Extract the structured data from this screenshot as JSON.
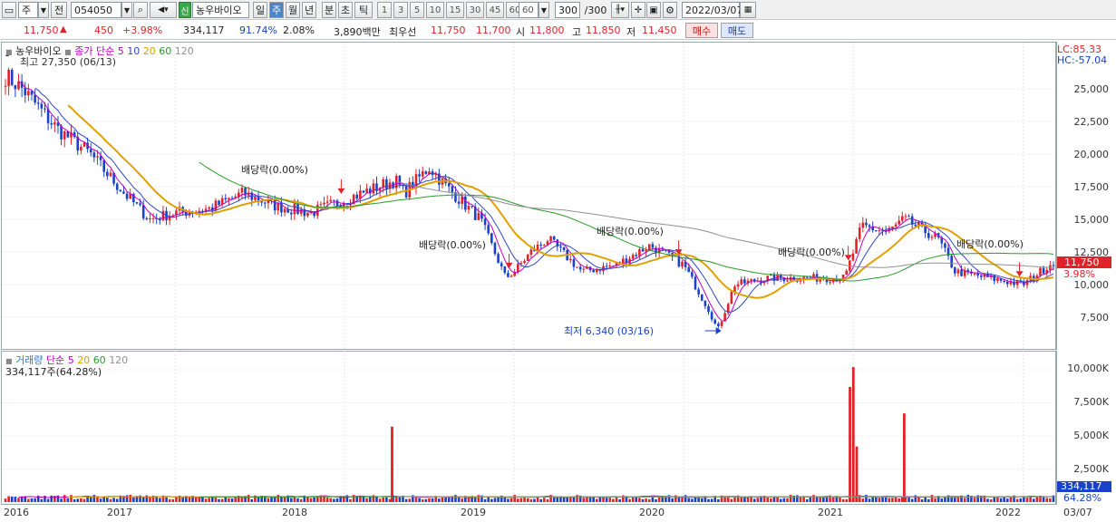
{
  "toolbar": {
    "market": "주",
    "prev_label": "전",
    "code": "054050",
    "new_badge": "신",
    "stock_name": "농우바이오",
    "periods": [
      "일",
      "주",
      "월",
      "년",
      "분",
      "초",
      "틱"
    ],
    "selected_period": "주",
    "intervals": [
      "1",
      "3",
      "5",
      "10",
      "15",
      "30",
      "45",
      "60"
    ],
    "interval_select": "60",
    "count": "300",
    "count_total": "/300",
    "date": "2022/03/07"
  },
  "quote": {
    "price": "11,750",
    "change": "450",
    "change_pct": "+3.98%",
    "volume": "334,117",
    "vol_ratio": "91.74%",
    "turnover": "2.08%",
    "amount": "3,890백만",
    "best_label": "최우선",
    "ask": "11,750",
    "bid": "11,700",
    "open_label": "시",
    "open": "11,800",
    "high_label": "고",
    "high": "11,850",
    "low_label": "저",
    "low": "11,450",
    "buy_label": "매수",
    "sell_label": "매도"
  },
  "price_panel": {
    "name": "농우바이오",
    "ma_label": "종가 단순",
    "ma_periods": [
      "5",
      "10",
      "20",
      "60",
      "120"
    ],
    "high_note": "최고 27,350 (06/13)",
    "low_note": "최저 6,340 (03/16)",
    "lc": "LC:85.33",
    "hc": "HC:-57.04",
    "current_tag": "11,750",
    "current_pct": "3.98%",
    "dividend_label": "배당락(0.00%)"
  },
  "volume_panel": {
    "name": "거래량",
    "ma_label": "단순",
    "ma_periods": [
      "5",
      "20",
      "60",
      "120"
    ],
    "current": "334,117주(64.28%)",
    "current_tag": "334,117",
    "current_pct": "64.28%"
  },
  "x_axis": [
    "2016",
    "2017",
    "2018",
    "2019",
    "2020",
    "2021",
    "2022",
    "03/07"
  ],
  "y_price_ticks": [
    "25,000",
    "22,500",
    "20,000",
    "17,500",
    "15,000",
    "12,500",
    "10,000",
    "7,500"
  ],
  "y_volume_ticks": [
    "10,000K",
    "7,500K",
    "5,000K",
    "2,500K"
  ],
  "colors": {
    "up": "#e0222a",
    "down": "#1843c8",
    "ma5": "#c000c0",
    "ma10": "#3048c0",
    "ma20": "#e0a000",
    "ma60": "#2a9a2a",
    "ma120": "#909090"
  },
  "chart_data": {
    "type": "candlestick",
    "x_start": "2016",
    "x_end": "2022/03/07",
    "ylim": [
      5000,
      29000
    ],
    "price_path": [
      [
        2016.0,
        26000
      ],
      [
        2016.1,
        25000
      ],
      [
        2016.3,
        22000
      ],
      [
        2016.5,
        20000
      ],
      [
        2016.7,
        17000
      ],
      [
        2016.85,
        15000
      ],
      [
        2017.0,
        15500
      ],
      [
        2017.2,
        15800
      ],
      [
        2017.4,
        17000
      ],
      [
        2017.6,
        16000
      ],
      [
        2017.8,
        15500
      ],
      [
        2018.0,
        16500
      ],
      [
        2018.1,
        17000
      ],
      [
        2018.3,
        18000
      ],
      [
        2018.35,
        17000
      ],
      [
        2018.5,
        19000
      ],
      [
        2018.6,
        17500
      ],
      [
        2018.8,
        15000
      ],
      [
        2018.95,
        10500
      ],
      [
        2019.0,
        11000
      ],
      [
        2019.1,
        12500
      ],
      [
        2019.2,
        13500
      ],
      [
        2019.4,
        11000
      ],
      [
        2019.6,
        11500
      ],
      [
        2019.8,
        13000
      ],
      [
        2020.0,
        11500
      ],
      [
        2020.15,
        8000
      ],
      [
        2020.2,
        6500
      ],
      [
        2020.3,
        10000
      ],
      [
        2020.5,
        10500
      ],
      [
        2020.7,
        10500
      ],
      [
        2020.95,
        10500
      ],
      [
        2021.05,
        14500
      ],
      [
        2021.2,
        14000
      ],
      [
        2021.3,
        15000
      ],
      [
        2021.5,
        13500
      ],
      [
        2021.6,
        11000
      ],
      [
        2021.8,
        10500
      ],
      [
        2022.0,
        10000
      ],
      [
        2022.18,
        11750
      ]
    ],
    "annotations": [
      {
        "text": "배당락(0.00%)",
        "x": 2017.98
      },
      {
        "text": "배당락(0.00%)",
        "x": 2018.97
      },
      {
        "text": "배당락(0.00%)",
        "x": 2019.97
      },
      {
        "text": "배당락(0.00%)",
        "x": 2020.97
      },
      {
        "text": "배당락(0.00%)",
        "x": 2021.98
      }
    ],
    "volume_spikes_k": [
      [
        2018.28,
        5700
      ],
      [
        2020.98,
        8700
      ],
      [
        2021.0,
        10200
      ],
      [
        2021.02,
        4200
      ],
      [
        2021.3,
        6700
      ]
    ]
  }
}
